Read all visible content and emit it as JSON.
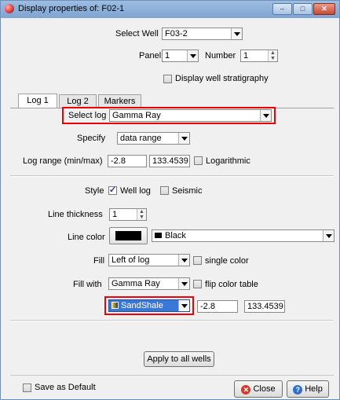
{
  "window": {
    "title": "Display properties of: F02-1",
    "min_label": "–",
    "max_label": "□",
    "close_label": "✕"
  },
  "well": {
    "select_label": "Select Well",
    "select_value": "F03-2"
  },
  "panel": {
    "panel_label": "Panel",
    "panel_value": "1",
    "number_label": "Number",
    "number_value": "1"
  },
  "stratigraphy": {
    "label": "Display well stratigraphy",
    "checked": false
  },
  "tabs": [
    {
      "label": "Log 1"
    },
    {
      "label": "Log 2"
    },
    {
      "label": "Markers"
    }
  ],
  "log": {
    "select_label": "Select log",
    "select_value": "Gamma Ray",
    "specify_label": "Specify",
    "specify_value": "data range",
    "range_label": "Log range (min/max)",
    "range_min": "-2.8",
    "range_max": "133.4539",
    "logarithmic_label": "Logarithmic"
  },
  "style": {
    "label": "Style",
    "well_log_label": "Well log",
    "seismic_label": "Seismic",
    "line_thickness_label": "Line thickness",
    "line_thickness_value": "1",
    "line_color_label": "Line color",
    "line_color_value": "Black",
    "line_color_hex": "#000000",
    "fill_label": "Fill",
    "fill_value": "Left of log",
    "single_color_label": "single color",
    "fill_with_label": "Fill with",
    "fill_with_value": "Gamma Ray",
    "flip_color_label": "flip color table",
    "color_table_value": "SandShale",
    "color_min": "-2.8",
    "color_max": "133.4539"
  },
  "buttons": {
    "apply_all": "Apply to all wells",
    "save_default": "Save as Default",
    "close": "Close",
    "help": "Help"
  },
  "colors": {
    "highlight": "#e00000",
    "selected_bg": "#3a78d8"
  }
}
